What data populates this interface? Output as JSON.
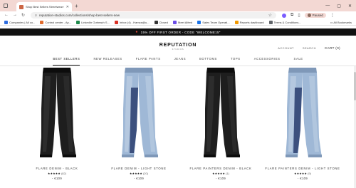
{
  "browser": {
    "tab_title": "Shop Best Sellers Streetwear Cl...",
    "url": "reputation-studios.com/collections/shop-best-sellers-new",
    "profile_label": "Paused",
    "bookmarks": [
      {
        "label": "Companies | All co...",
        "color": "#2d6cdf"
      },
      {
        "label": "Control center - Ap...",
        "color": "#e06b2d"
      },
      {
        "label": "LinkedIn Outreach S...",
        "color": "#1f8a4c"
      },
      {
        "label": "Inbox (4) - Hamza@u...",
        "color": "#d93025"
      },
      {
        "label": "Closed",
        "color": "#333333"
      },
      {
        "label": "Meet Alfred",
        "color": "#6b4de6"
      },
      {
        "label": "Sales Team Operati...",
        "color": "#1a73e8"
      },
      {
        "label": "Reports dashboard",
        "color": "#f29900"
      },
      {
        "label": "Terms & Conditions...",
        "color": "#5f6368"
      }
    ],
    "all_bookmarks_label": "All Bookmarks"
  },
  "promo": {
    "text": "15% OFF FIRST ORDER - CODE \"WELCOME15\""
  },
  "header": {
    "logo": "REPUTATION",
    "logo_sub": "STUDIOS",
    "account": "ACCOUNT",
    "search": "SEARCH",
    "cart": "CART (0)"
  },
  "nav": {
    "items": [
      "BEST SELLERS",
      "NEW RELEASES",
      "FLARE PANTS",
      "JEANS",
      "BOTTOMS",
      "TOPS",
      "ACCESSORIES",
      "SALE"
    ],
    "active": "BEST SELLERS"
  },
  "products": [
    {
      "name": "FLARE DENIM - BLACK",
      "stars": "★★★★★",
      "count": "(82)",
      "price": "€109",
      "wash": "black"
    },
    {
      "name": "FLARE DENIM - LIGHT STONE",
      "stars": "★★★★★",
      "count": "(20)",
      "price": "€109",
      "wash": "light"
    },
    {
      "name": "FLARE PAINTERS DENIM - BLACK",
      "stars": "★★★★★",
      "count": "(1)",
      "price": "€109",
      "wash": "black"
    },
    {
      "name": "FLARE PAINTERS DENIM - LIGHT STONE",
      "stars": "★★★★★",
      "count": "(9)",
      "price": "€109",
      "wash": "light"
    }
  ],
  "colors": {
    "promo_bg": "#111111",
    "chrome_tab": "#f3d8d3"
  }
}
